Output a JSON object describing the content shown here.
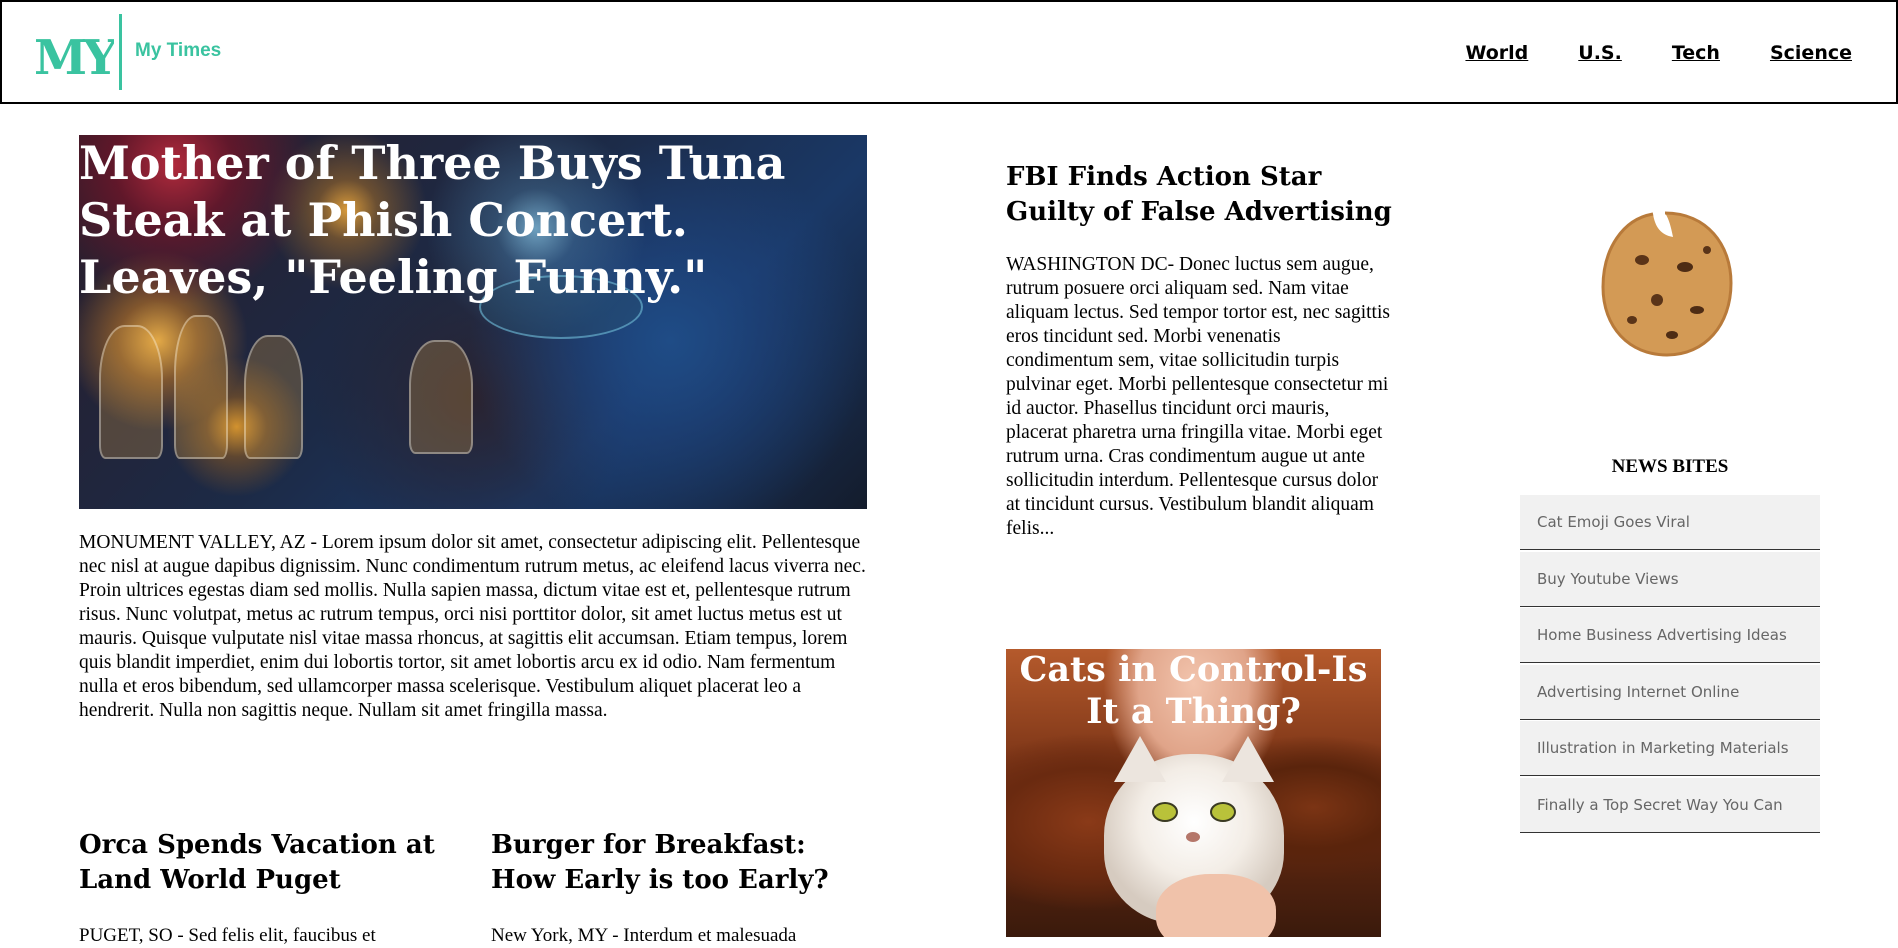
{
  "header": {
    "logo_text": "MYT",
    "brand": "My Times",
    "nav": [
      "World",
      "U.S.",
      "Tech",
      "Science"
    ]
  },
  "hero": {
    "title": "Mother of Three Buys Tuna Steak at Phish Concert. Leaves, \"Feeling Funny.\"",
    "body": "MONUMENT VALLEY, AZ - Lorem ipsum dolor sit amet, consectetur adipiscing elit. Pellentesque nec nisl at augue dapibus dignissim. Nunc condimentum rutrum metus, ac eleifend lacus viverra nec. Proin ultrices egestas diam sed mollis. Nulla sapien massa, dictum vitae est et, pellentesque rutrum risus. Nunc volutpat, metus ac rutrum tempus, orci nisi porttitor dolor, sit amet luctus metus est ut mauris. Quisque vulputate nisl vitae massa rhoncus, at sagittis elit accumsan. Etiam tempus, lorem quis blandit imperdiet, enim dui lobortis tortor, sit amet lobortis arcu ex id odio. Nam fermentum nulla et eros bibendum, sed ullamcorper massa scelerisque. Vestibulum aliquet placerat leo a hendrerit. Nulla non sagittis neque. Nullam sit amet fringilla massa."
  },
  "stories": [
    {
      "title": "Orca Spends Vacation at Land World Puget",
      "snippet": "PUGET, SO - Sed felis elit, faucibus et"
    },
    {
      "title": "Burger for Breakfast: How Early is too Early?",
      "snippet": "New York, MY - Interdum et malesuada"
    }
  ],
  "feature": {
    "title": "FBI Finds Action Star Guilty of False Advertising",
    "body": "WASHINGTON DC- Donec luctus sem augue, rutrum posuere orci aliquam sed. Nam vitae aliquam lectus. Sed tempor tortor est, nec sagittis eros tincidunt sed. Morbi venenatis condimentum sem, vitae sollicitudin turpis pulvinar eget. Morbi pellentesque consectetur mi id auctor. Phasellus tincidunt orci mauris, placerat pharetra urna fringilla vitae. Morbi eget rutrum urna. Cras condimentum augue ut ante sollicitudin interdum. Pellentesque cursus dolor at tincidunt cursus. Vestibulum blandit aliquam felis..."
  },
  "cat_card": {
    "title": "Cats in Control-Is It a Thing?"
  },
  "sidebar": {
    "heading": "NEWS BITES",
    "items": [
      "Cat Emoji Goes Viral",
      "Buy Youtube Views",
      "Home Business Advertising Ideas",
      "Advertising Internet Online",
      "Illustration in Marketing Materials",
      "Finally a Top Secret Way You Can"
    ]
  },
  "colors": {
    "accent": "#3ac3a0",
    "logo_dark": "#555555",
    "sidebar_bg": "#f1f1f1"
  }
}
